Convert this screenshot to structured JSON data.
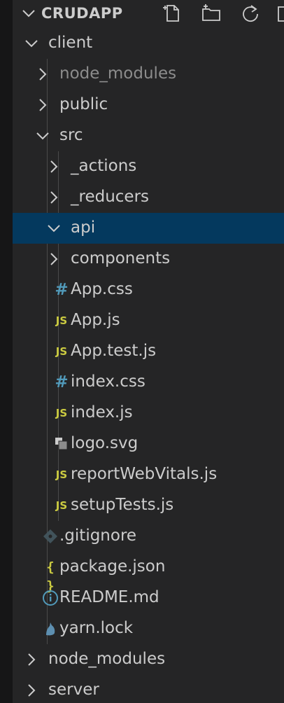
{
  "header": {
    "title": "CRUDAPP",
    "actions": [
      {
        "icon": "new-file-icon"
      },
      {
        "icon": "new-folder-icon"
      },
      {
        "icon": "refresh-icon"
      },
      {
        "icon": "collapse-all-icon"
      }
    ]
  },
  "tree": [
    {
      "label": "client",
      "kind": "folder",
      "expanded": true,
      "depth": 0
    },
    {
      "label": "node_modules",
      "kind": "folder",
      "expanded": false,
      "depth": 1,
      "dim": true
    },
    {
      "label": "public",
      "kind": "folder",
      "expanded": false,
      "depth": 1
    },
    {
      "label": "src",
      "kind": "folder",
      "expanded": true,
      "depth": 1
    },
    {
      "label": "_actions",
      "kind": "folder",
      "expanded": false,
      "depth": 2
    },
    {
      "label": "_reducers",
      "kind": "folder",
      "expanded": false,
      "depth": 2
    },
    {
      "label": "api",
      "kind": "folder",
      "expanded": true,
      "depth": 2,
      "selected": true
    },
    {
      "label": "components",
      "kind": "folder",
      "expanded": false,
      "depth": 2
    },
    {
      "label": "App.css",
      "kind": "file",
      "icon": "css-hash-icon",
      "depth": 2
    },
    {
      "label": "App.js",
      "kind": "file",
      "icon": "js-file-icon",
      "depth": 2
    },
    {
      "label": "App.test.js",
      "kind": "file",
      "icon": "js-file-icon",
      "depth": 2
    },
    {
      "label": "index.css",
      "kind": "file",
      "icon": "css-hash-icon",
      "depth": 2
    },
    {
      "label": "index.js",
      "kind": "file",
      "icon": "js-file-icon",
      "depth": 2
    },
    {
      "label": "logo.svg",
      "kind": "file",
      "icon": "svg-image-icon",
      "depth": 2
    },
    {
      "label": "reportWebVitals.js",
      "kind": "file",
      "icon": "js-file-icon",
      "depth": 2
    },
    {
      "label": "setupTests.js",
      "kind": "file",
      "icon": "js-file-icon",
      "depth": 2
    },
    {
      "label": ".gitignore",
      "kind": "file",
      "icon": "git-diamond-icon",
      "depth": 1
    },
    {
      "label": "package.json",
      "kind": "file",
      "icon": "json-braces-icon",
      "depth": 1
    },
    {
      "label": "README.md",
      "kind": "file",
      "icon": "info-circle-icon",
      "depth": 1
    },
    {
      "label": "yarn.lock",
      "kind": "file",
      "icon": "yarn-cat-icon",
      "depth": 1
    },
    {
      "label": "node_modules",
      "kind": "folder",
      "expanded": false,
      "depth": 0
    },
    {
      "label": "server",
      "kind": "folder",
      "expanded": false,
      "depth": 0
    }
  ],
  "text": {
    "js_badge": "JS",
    "css_badge": "#",
    "json_badge": "{ }"
  },
  "colors": {
    "sidebar_bg": "#252526",
    "selection_bg": "#04395e",
    "text": "#cccccc",
    "dim_text": "#8c8c8c",
    "js_yellow": "#cbcb41",
    "css_blue": "#519aba"
  }
}
